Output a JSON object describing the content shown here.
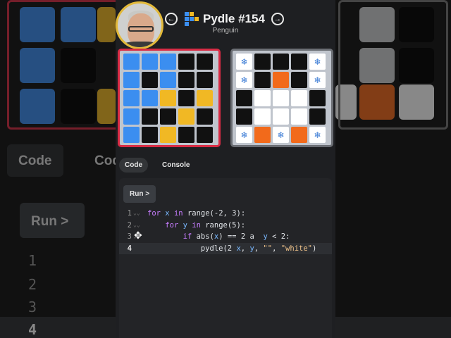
{
  "header": {
    "title": "Pydle #154",
    "subtitle": "Penguin",
    "prev_icon": "←",
    "next_icon": "→"
  },
  "colors": {
    "blue": "#3b8ef0",
    "black": "#111111",
    "yellow": "#f1b824",
    "white": "#ffffff",
    "orange": "#f26a1b",
    "accent_red": "#d92b44"
  },
  "left_grid": {
    "cells": [
      [
        "blue",
        "blue",
        "blue",
        "black",
        "black"
      ],
      [
        "blue",
        "black",
        "blue",
        "black",
        "black"
      ],
      [
        "blue",
        "blue",
        "yellow",
        "black",
        "yellow"
      ],
      [
        "blue",
        "black",
        "black",
        "yellow",
        "black"
      ],
      [
        "blue",
        "black",
        "yellow",
        "black",
        "black"
      ]
    ]
  },
  "right_grid": {
    "cells": [
      [
        "snow",
        "black",
        "black",
        "black",
        "snow"
      ],
      [
        "snow",
        "black",
        "orange",
        "black",
        "snow"
      ],
      [
        "black",
        "white",
        "white",
        "white",
        "black"
      ],
      [
        "black",
        "white",
        "white",
        "white",
        "black"
      ],
      [
        "snow",
        "orange",
        "snow",
        "orange",
        "snow"
      ]
    ],
    "snow_icon": "❄"
  },
  "tabs": {
    "code": "Code",
    "console": "Console"
  },
  "editor": {
    "run_label": "Run >",
    "lines": [
      {
        "num": "1",
        "text": "for x in range(-2, 3):"
      },
      {
        "num": "2",
        "text": "    for y in range(5):"
      },
      {
        "num": "3",
        "text": "        if abs(x) == 2 a  y < 2:"
      },
      {
        "num": "4",
        "text": "            pydle(2 x, y, \"\", \"white\")"
      }
    ]
  },
  "background": {
    "code_label": "Code",
    "run_label": "Run >",
    "nums": [
      "1",
      "2",
      "3",
      "4"
    ]
  }
}
